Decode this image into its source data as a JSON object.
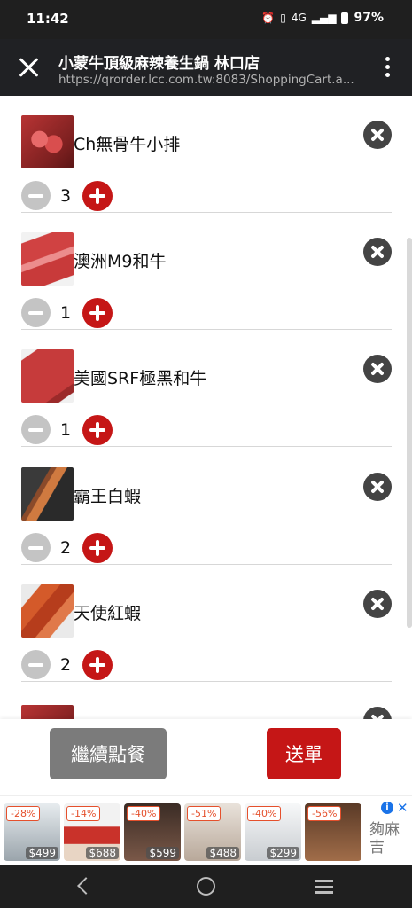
{
  "status_bar": {
    "time": "11:42",
    "network": "4G",
    "battery": "97%"
  },
  "app_bar": {
    "title": "小蒙牛頂級麻辣養生鍋 林口店",
    "url": "https://qrorder.lcc.com.tw:8083/ShoppingCart.a..."
  },
  "cart": {
    "items": [
      {
        "name": "Ch無骨牛小排",
        "qty": "3",
        "image": "meat"
      },
      {
        "name": "澳洲M9和牛",
        "qty": "1",
        "image": "meat2"
      },
      {
        "name": "美國SRF極黑和牛",
        "qty": "1",
        "image": "meat3"
      },
      {
        "name": "霸王白蝦",
        "qty": "2",
        "image": "shrimp"
      },
      {
        "name": "天使紅蝦",
        "qty": "2",
        "image": "shrimp2"
      }
    ]
  },
  "actions": {
    "continue_label": "繼續點餐",
    "submit_label": "送單"
  },
  "ad": {
    "products": [
      {
        "discount": "-28%",
        "price": "$499"
      },
      {
        "discount": "-14%",
        "price": "$688"
      },
      {
        "discount": "-40%",
        "price": "$599"
      },
      {
        "discount": "-51%",
        "price": "$488"
      },
      {
        "discount": "-40%",
        "price": "$299"
      },
      {
        "discount": "-56%",
        "price": ""
      }
    ],
    "brand": "夠麻吉"
  },
  "colors": {
    "accent_red": "#c51616",
    "appbar": "#202124",
    "continue_gray": "#7b7b7b"
  }
}
